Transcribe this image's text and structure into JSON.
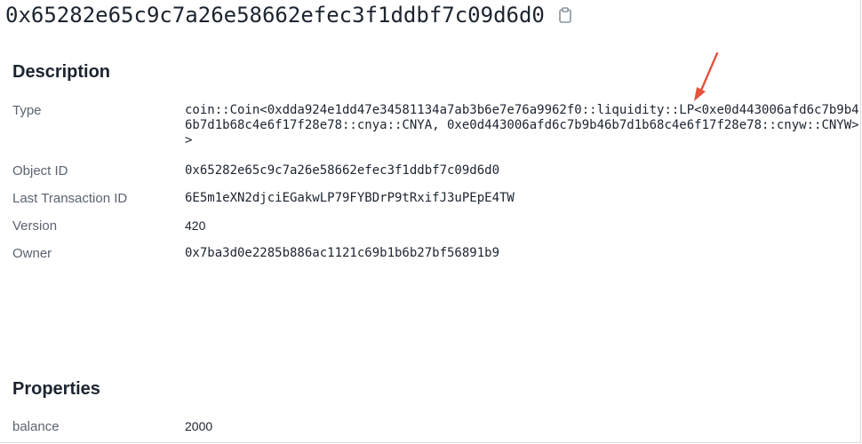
{
  "header": {
    "title": "0x65282e65c9c7a26e58662efec3f1ddbf7c09d6d0",
    "copy_icon": "copy-icon"
  },
  "description": {
    "heading": "Description",
    "type_label": "Type",
    "type_value": "coin::Coin<0xdda924e1dd47e34581134a7ab3b6e7e76a9962f0::liquidity::LP<0xe0d443006afd6c7b9b46b7d1b68c4e6f17f28e78::cnya::CNYA, 0xe0d443006afd6c7b9b46b7d1b68c4e6f17f28e78::cnyw::CNYW>>",
    "object_id_label": "Object ID",
    "object_id_value": "0x65282e65c9c7a26e58662efec3f1ddbf7c09d6d0",
    "last_tx_label": "Last Transaction ID",
    "last_tx_value": "6E5m1eXN2djciEGakwLP79FYBDrP9tRxifJ3uPEpE4TW",
    "version_label": "Version",
    "version_value": "420",
    "owner_label": "Owner",
    "owner_value": "0x7ba3d0e2285b886ac1121c69b1b6b27bf56891b9"
  },
  "properties": {
    "heading": "Properties",
    "balance_label": "balance",
    "balance_value": "2000"
  },
  "colors": {
    "link": "#1d5a8e",
    "label": "#5a6370",
    "text": "#1b2430",
    "annotation_arrow": "#e5533d"
  }
}
